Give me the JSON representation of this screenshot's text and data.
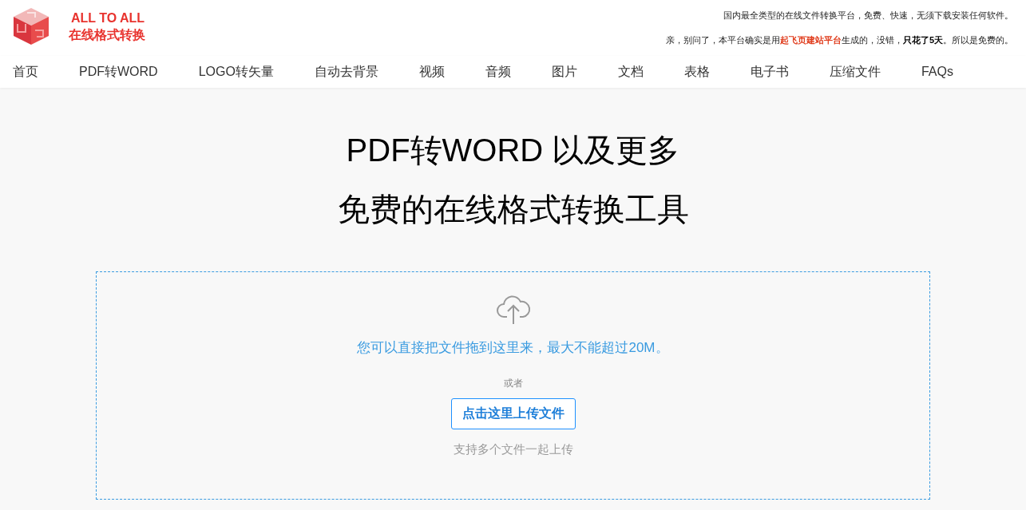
{
  "logo": {
    "title": "ALL TO ALL",
    "subtitle": "在线格式转换"
  },
  "tagline": "国内最全类型的在线文件转换平台，免费、快速，无须下载安装任何软件。",
  "notice": [
    {
      "kind": "text",
      "text": "亲，别问了，本平台确实是用"
    },
    {
      "kind": "link",
      "text": "起飞页建站平台"
    },
    {
      "kind": "text",
      "text": "生成的，没错，"
    },
    {
      "kind": "bold",
      "text": "只花了5天"
    },
    {
      "kind": "text",
      "text": "。所以是免费的。"
    }
  ],
  "nav": [
    "首页",
    "PDF转WORD",
    "LOGO转矢量",
    "自动去背景",
    "视频",
    "音频",
    "图片",
    "文档",
    "表格",
    "电子书",
    "压缩文件",
    "FAQs"
  ],
  "hero": {
    "line_1": "PDF转WORD 以及更多",
    "line_2": "免费的在线格式转换工具"
  },
  "upload": {
    "hint": "您可以直接把文件拖到这里来，最大不能超过20M。",
    "or": "或者",
    "button": "点击这里上传文件",
    "note": "支持多个文件一起上传"
  }
}
